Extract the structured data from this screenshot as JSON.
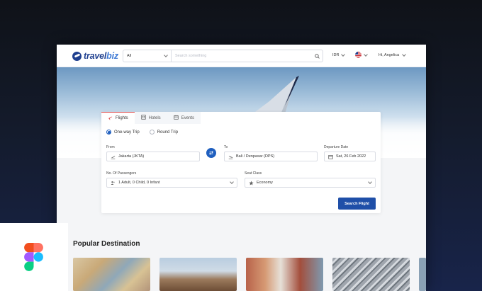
{
  "header": {
    "logo_bold": "travel",
    "logo_light": "biz",
    "search_category": "All",
    "search_placeholder": "Search something",
    "currency": "IDR",
    "greeting": "Hi, Angelica"
  },
  "tabs": [
    {
      "label": "Flights",
      "icon": "plane-icon"
    },
    {
      "label": "Hotels",
      "icon": "hotel-icon"
    },
    {
      "label": "Events",
      "icon": "events-icon"
    }
  ],
  "trip_type": {
    "options": [
      "One-way Trip",
      "Round Trip"
    ],
    "selected": "One-way Trip"
  },
  "form": {
    "from_label": "From",
    "from_value": "Jakarta (JKTA)",
    "to_label": "To",
    "to_value": "Bali / Denpasar (DPS)",
    "date_label": "Departure Date",
    "date_value": "Sat, 26 Feb 2022",
    "passengers_label": "No. Of Passengers",
    "passengers_value": "1 Adult, 0 Child, 0 Infant",
    "class_label": "Seat Class",
    "class_value": "Economy",
    "search_button": "Search Flight"
  },
  "popular": {
    "title": "Popular Destination"
  },
  "colors": {
    "brand": "#1f3f8f",
    "primary_button": "#1f4fa8",
    "active_tab_accent": "#e04848"
  }
}
